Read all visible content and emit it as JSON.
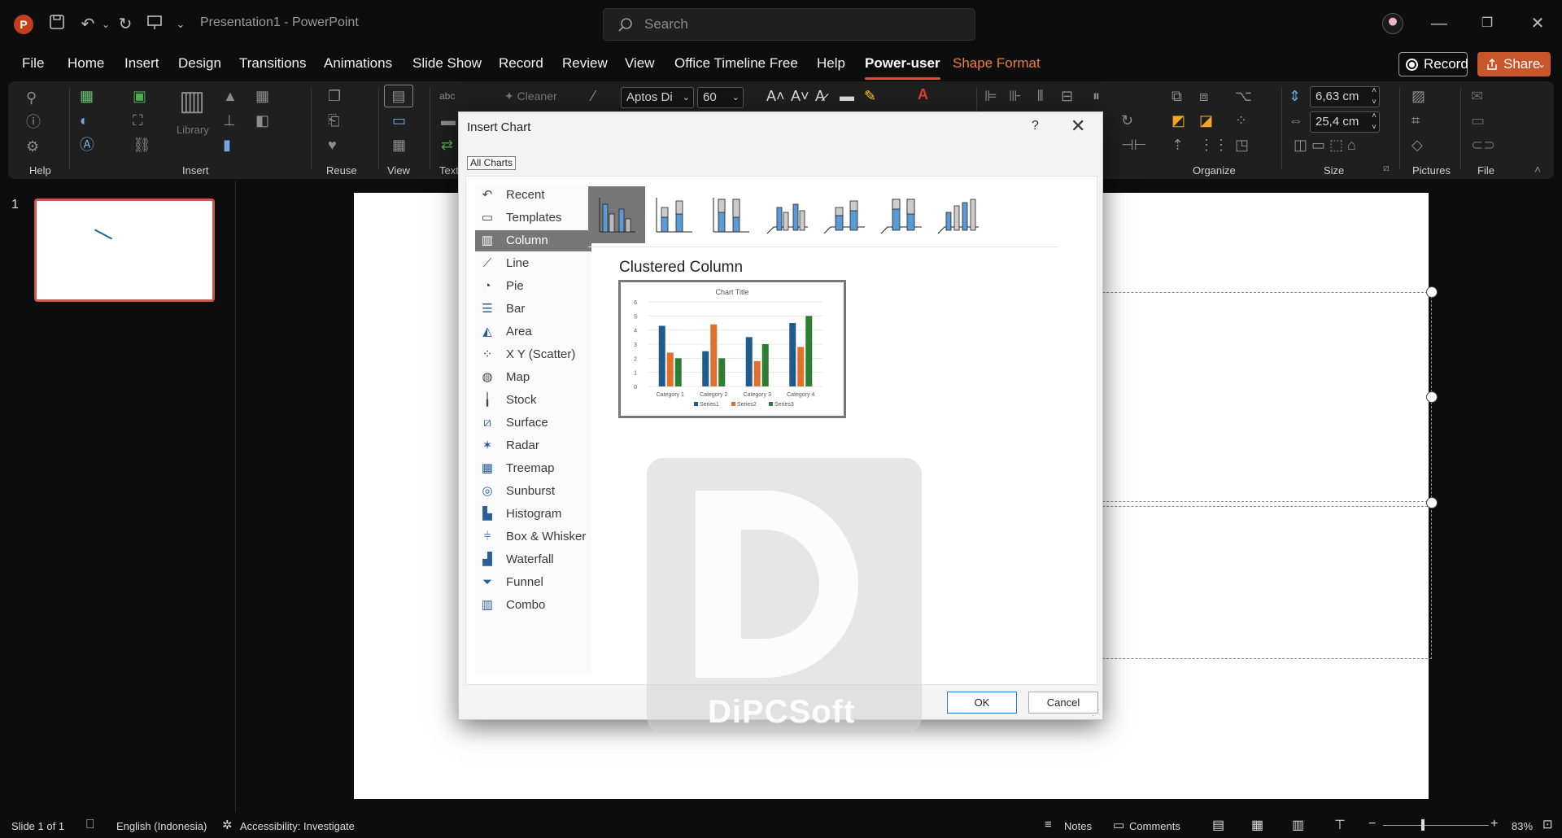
{
  "app": {
    "title": "Presentation1  -  PowerPoint",
    "logo": "P"
  },
  "search": {
    "placeholder": "Search"
  },
  "menu": [
    "File",
    "Home",
    "Insert",
    "Design",
    "Transitions",
    "Animations",
    "Slide Show",
    "Record",
    "Review",
    "View",
    "Office Timeline Free",
    "Help",
    "Power-user",
    "Shape Format"
  ],
  "menu_active": "Power-user",
  "buttons": {
    "record": "Record",
    "share": "Share"
  },
  "ribbon": {
    "groups": [
      "Help",
      "Insert",
      "Reuse",
      "View",
      "Text",
      "Organize",
      "Size",
      "Pictures",
      "File"
    ],
    "library_label": "Library",
    "cleaner_label": "Cleaner",
    "font_name": "Aptos Di",
    "font_size": "60",
    "height": "6,63 cm",
    "width": "25,4 cm"
  },
  "slides": {
    "number": "1"
  },
  "dialog": {
    "title": "Insert Chart",
    "help": "?",
    "tab": "All Charts",
    "types": [
      "Recent",
      "Templates",
      "Column",
      "Line",
      "Pie",
      "Bar",
      "Area",
      "X Y (Scatter)",
      "Map",
      "Stock",
      "Surface",
      "Radar",
      "Treemap",
      "Sunburst",
      "Histogram",
      "Box & Whisker",
      "Waterfall",
      "Funnel",
      "Combo"
    ],
    "selected_type": "Column",
    "subtype_title": "Clustered Column",
    "ok": "OK",
    "cancel": "Cancel"
  },
  "watermark": {
    "text": "DiPCSoft"
  },
  "chart_data": {
    "type": "bar",
    "title": "Chart Title",
    "categories": [
      "Category 1",
      "Category 2",
      "Category 3",
      "Category 4"
    ],
    "series": [
      {
        "name": "Series1",
        "values": [
          4.3,
          2.5,
          3.5,
          4.5
        ],
        "color": "#1f5c8b"
      },
      {
        "name": "Series2",
        "values": [
          2.4,
          4.4,
          1.8,
          2.8
        ],
        "color": "#e0702b"
      },
      {
        "name": "Series3",
        "values": [
          2,
          2,
          3,
          5
        ],
        "color": "#2e7d32"
      }
    ],
    "ylim": [
      0,
      6
    ],
    "yticks": [
      "0",
      "1",
      "2",
      "3",
      "4",
      "5",
      "6"
    ],
    "grid": true,
    "legend": "bottom"
  },
  "status": {
    "slide": "Slide 1 of 1",
    "language": "English (Indonesia)",
    "accessibility": "Accessibility: Investigate",
    "notes": "Notes",
    "comments": "Comments",
    "zoom": "83%"
  }
}
